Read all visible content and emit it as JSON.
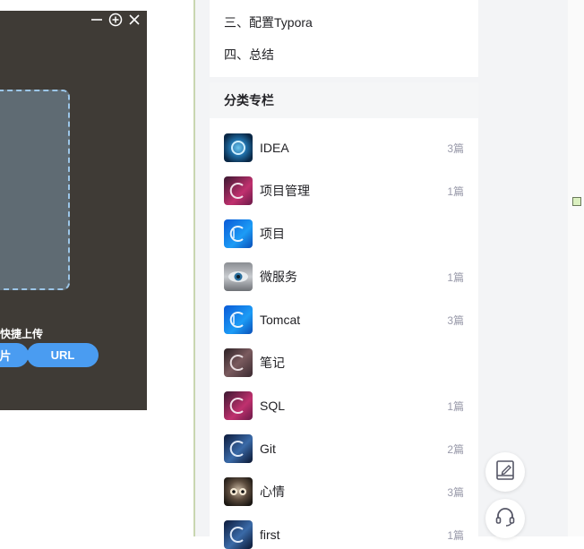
{
  "uploader": {
    "shortcut_text": "快捷上传",
    "picture_button": "片",
    "url_button": "URL"
  },
  "toc": {
    "items": [
      "三、配置Typora",
      "四、总结"
    ]
  },
  "columns": {
    "header": "分类专栏",
    "items": [
      {
        "name": "IDEA",
        "count": "3篇",
        "thumb": "idea"
      },
      {
        "name": "项目管理",
        "count": "1篇",
        "thumb": "pink-c"
      },
      {
        "name": "项目",
        "count": "",
        "thumb": "blue-c"
      },
      {
        "name": "微服务",
        "count": "1篇",
        "thumb": "eye"
      },
      {
        "name": "Tomcat",
        "count": "3篇",
        "thumb": "blue-c"
      },
      {
        "name": "笔记",
        "count": "",
        "thumb": "dark-c"
      },
      {
        "name": "SQL",
        "count": "1篇",
        "thumb": "pink-c"
      },
      {
        "name": "Git",
        "count": "2篇",
        "thumb": "night-c"
      },
      {
        "name": "心情",
        "count": "3篇",
        "thumb": "owl"
      },
      {
        "name": "first",
        "count": "1篇",
        "thumb": "night-c"
      }
    ]
  },
  "colors": {
    "accent_blue": "#4a9cf1",
    "uploader_bg": "#3f3b36",
    "text": "#222226",
    "muted": "#999aaa"
  }
}
